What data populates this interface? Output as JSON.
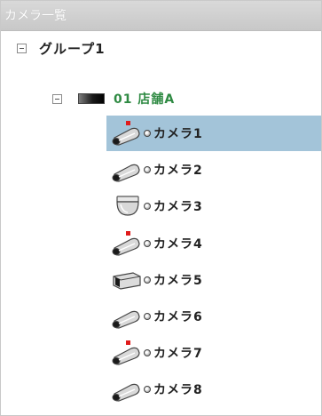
{
  "panel": {
    "title": "カメラ一覧"
  },
  "tree": {
    "group": {
      "label": "グループ1",
      "expanded": true
    },
    "store": {
      "label": "01 店舗A",
      "expanded": true,
      "color": "#2f8a43"
    },
    "cameras": [
      {
        "label": "カメラ1",
        "icon": "bullet-camera-icon",
        "recording": true,
        "selected": true
      },
      {
        "label": "カメラ2",
        "icon": "bullet-camera-icon",
        "recording": false,
        "selected": false
      },
      {
        "label": "カメラ3",
        "icon": "dome-camera-icon",
        "recording": false,
        "selected": false
      },
      {
        "label": "カメラ4",
        "icon": "bullet-camera-icon",
        "recording": true,
        "selected": false
      },
      {
        "label": "カメラ5",
        "icon": "box-camera-icon",
        "recording": false,
        "selected": false
      },
      {
        "label": "カメラ6",
        "icon": "bullet-camera-icon",
        "recording": false,
        "selected": false
      },
      {
        "label": "カメラ7",
        "icon": "bullet-camera-icon",
        "recording": true,
        "selected": false
      },
      {
        "label": "カメラ8",
        "icon": "bullet-camera-icon",
        "recording": false,
        "selected": false
      }
    ]
  },
  "colors": {
    "selected_row": "#a3c4d9",
    "recording_marker": "#e01b1b",
    "header_bg": "#cfcfcf"
  }
}
